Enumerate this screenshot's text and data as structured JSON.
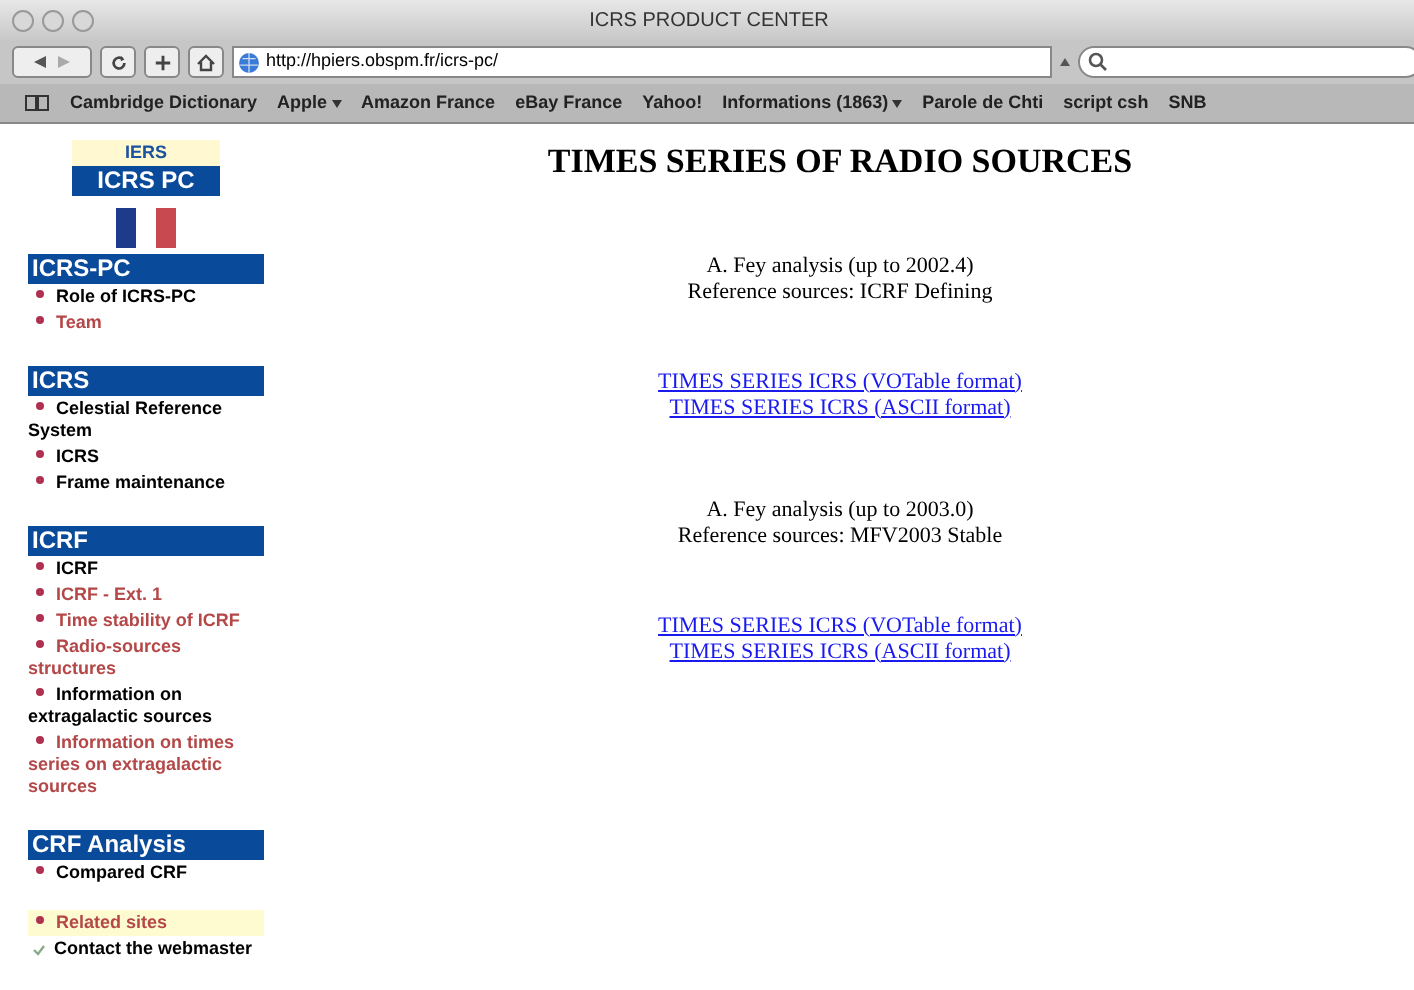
{
  "window": {
    "title": "ICRS PRODUCT CENTER"
  },
  "toolbar": {
    "url": "http://hpiers.obspm.fr/icrs-pc/"
  },
  "bookmarks": [
    {
      "label": "Cambridge Dictionary",
      "menu": false
    },
    {
      "label": "Apple",
      "menu": true
    },
    {
      "label": "Amazon France",
      "menu": false
    },
    {
      "label": "eBay France",
      "menu": false
    },
    {
      "label": "Yahoo!",
      "menu": false
    },
    {
      "label": "Informations (1863)",
      "menu": true
    },
    {
      "label": "Parole de Chti",
      "menu": false
    },
    {
      "label": "script csh",
      "menu": false
    },
    {
      "label": "SNB",
      "menu": false
    }
  ],
  "logo": {
    "top": "IERS",
    "bottom": "ICRS PC"
  },
  "sidebar": [
    {
      "heading": "ICRS-PC",
      "items": [
        {
          "label": "Role of ICRS-PC",
          "visited": false
        },
        {
          "label": "Team",
          "visited": true
        }
      ]
    },
    {
      "heading": "ICRS",
      "items": [
        {
          "label": "Celestial Reference System",
          "visited": false
        },
        {
          "label": "ICRS",
          "visited": false
        },
        {
          "label": "Frame maintenance",
          "visited": false
        }
      ]
    },
    {
      "heading": "ICRF",
      "items": [
        {
          "label": "ICRF",
          "visited": false
        },
        {
          "label": "ICRF - Ext. 1",
          "visited": true
        },
        {
          "label": "Time stability of ICRF",
          "visited": true
        },
        {
          "label": "Radio-sources structures",
          "visited": true
        },
        {
          "label": "Information on extragalactic sources",
          "visited": false
        },
        {
          "label": "Information on times series on extragalactic sources",
          "visited": true
        }
      ]
    },
    {
      "heading": "CRF Analysis",
      "items": [
        {
          "label": "Compared CRF",
          "visited": false
        }
      ]
    }
  ],
  "extra_links": [
    {
      "label": "Related sites",
      "visited": true,
      "highlighted": true,
      "kind": "bullet"
    },
    {
      "label": "Contact the webmaster",
      "visited": false,
      "highlighted": false,
      "kind": "check"
    }
  ],
  "main": {
    "title": "TIMES SERIES OF RADIO SOURCES",
    "sections": [
      {
        "lines": [
          "A. Fey analysis (up to 2002.4)",
          "Reference sources: ICRF Defining"
        ],
        "links": [
          "TIMES SERIES ICRS (VOTable format)",
          "TIMES SERIES ICRS (ASCII format)"
        ]
      },
      {
        "lines": [
          "A. Fey analysis (up to 2003.0)",
          "Reference sources: MFV2003 Stable"
        ],
        "links": [
          "TIMES SERIES ICRS (VOTable format)",
          "TIMES SERIES ICRS (ASCII format)"
        ]
      }
    ]
  }
}
